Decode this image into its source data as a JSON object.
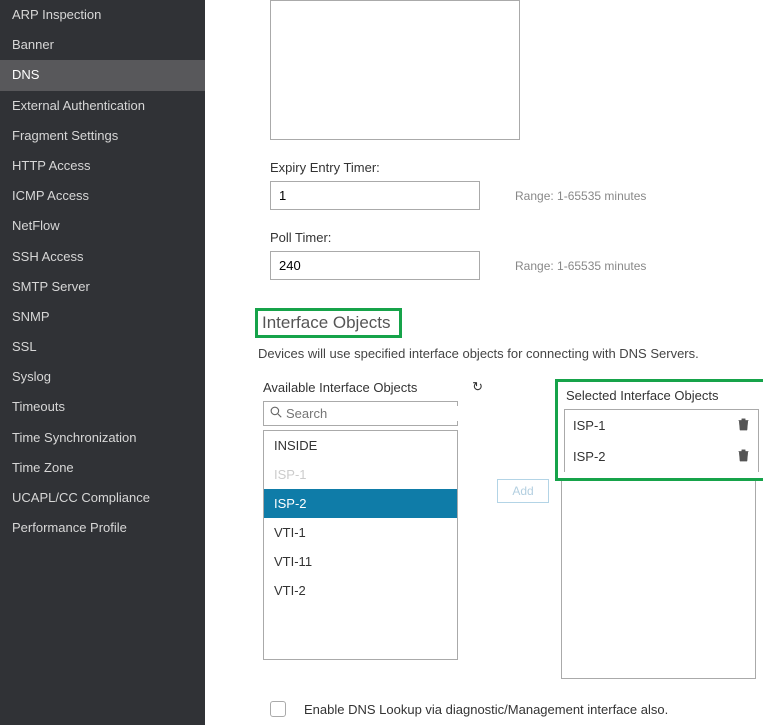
{
  "sidebar": {
    "items": [
      {
        "label": "ARP Inspection"
      },
      {
        "label": "Banner"
      },
      {
        "label": "DNS"
      },
      {
        "label": "External Authentication"
      },
      {
        "label": "Fragment Settings"
      },
      {
        "label": "HTTP Access"
      },
      {
        "label": "ICMP Access"
      },
      {
        "label": "NetFlow"
      },
      {
        "label": "SSH Access"
      },
      {
        "label": "SMTP Server"
      },
      {
        "label": "SNMP"
      },
      {
        "label": "SSL"
      },
      {
        "label": "Syslog"
      },
      {
        "label": "Timeouts"
      },
      {
        "label": "Time Synchronization"
      },
      {
        "label": "Time Zone"
      },
      {
        "label": "UCAPL/CC Compliance"
      },
      {
        "label": "Performance Profile"
      }
    ],
    "active_index": 2
  },
  "expiry": {
    "label": "Expiry Entry Timer:",
    "value": "1",
    "hint": "Range: 1-65535 minutes"
  },
  "poll": {
    "label": "Poll Timer:",
    "value": "240",
    "hint": "Range: 1-65535 minutes"
  },
  "section": {
    "title": "Interface Objects",
    "desc": "Devices will use specified interface objects for connecting with DNS Servers."
  },
  "available": {
    "label": "Available Interface Objects",
    "search_placeholder": "Search",
    "items": [
      {
        "label": "INSIDE",
        "state": "normal"
      },
      {
        "label": "ISP-1",
        "state": "disabled"
      },
      {
        "label": "ISP-2",
        "state": "selected"
      },
      {
        "label": "VTI-1",
        "state": "normal"
      },
      {
        "label": "VTI-11",
        "state": "normal"
      },
      {
        "label": "VTI-2",
        "state": "normal"
      }
    ]
  },
  "add_button": "Add",
  "selected": {
    "label": "Selected Interface Objects",
    "items": [
      {
        "label": "ISP-1"
      },
      {
        "label": "ISP-2"
      }
    ]
  },
  "checkbox": {
    "label": "Enable DNS Lookup via diagnostic/Management interface also."
  }
}
